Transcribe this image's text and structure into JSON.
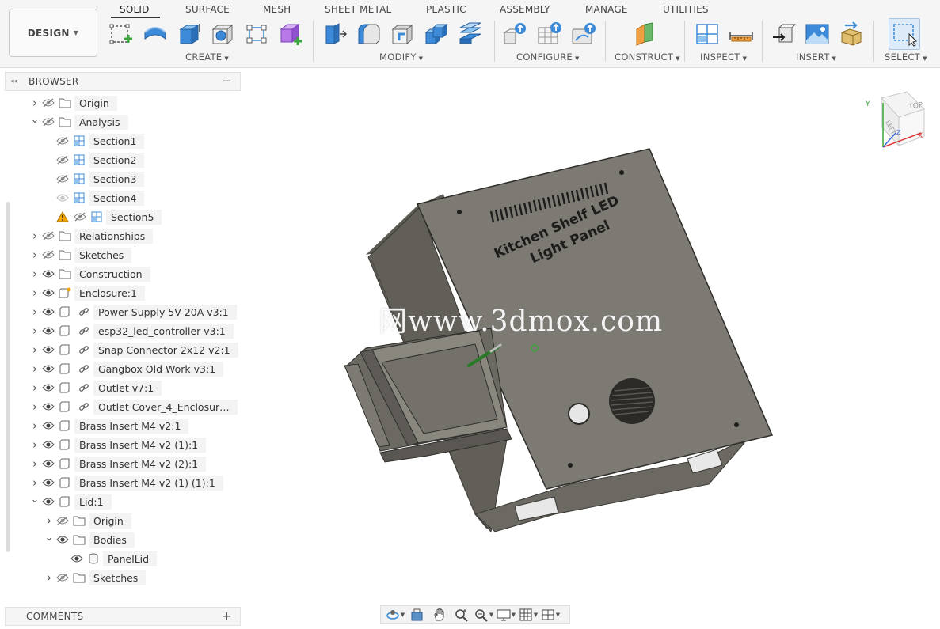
{
  "workspace": {
    "label": "DESIGN"
  },
  "tabs": [
    "SOLID",
    "SURFACE",
    "MESH",
    "SHEET METAL",
    "PLASTIC",
    "ASSEMBLY",
    "MANAGE",
    "UTILITIES"
  ],
  "active_tab": "SOLID",
  "groups": [
    "CREATE",
    "MODIFY",
    "CONFIGURE",
    "CONSTRUCT",
    "INSPECT",
    "INSERT",
    "SELECT"
  ],
  "browser": {
    "title": "BROWSER",
    "items": [
      {
        "label": "Origin",
        "depth": 0,
        "chevron": "right",
        "visible": false,
        "icon": "folder-icon"
      },
      {
        "label": "Analysis",
        "depth": 0,
        "chevron": "down",
        "visible": false,
        "icon": "folder-icon"
      },
      {
        "label": "Section1",
        "depth": 1,
        "chevron": "",
        "visible": false,
        "icon": "section-analysis-icon"
      },
      {
        "label": "Section2",
        "depth": 1,
        "chevron": "",
        "visible": false,
        "icon": "section-analysis-icon"
      },
      {
        "label": "Section3",
        "depth": 1,
        "chevron": "",
        "visible": false,
        "icon": "section-analysis-icon"
      },
      {
        "label": "Section4",
        "depth": 1,
        "chevron": "",
        "visible": true,
        "faded": true,
        "icon": "section-analysis-icon"
      },
      {
        "label": "Section5",
        "depth": 1,
        "chevron": "",
        "visible": false,
        "warning": true,
        "icon": "section-analysis-icon"
      },
      {
        "label": "Relationships",
        "depth": 0,
        "chevron": "right",
        "visible": false,
        "icon": "folder-icon"
      },
      {
        "label": "Sketches",
        "depth": 0,
        "chevron": "right",
        "visible": false,
        "icon": "folder-icon"
      },
      {
        "label": "Construction",
        "depth": 0,
        "chevron": "right",
        "visible": true,
        "icon": "folder-icon"
      },
      {
        "label": "Enclosure:1",
        "depth": 0,
        "chevron": "right",
        "visible": true,
        "icon": "active-component-icon"
      },
      {
        "label": "Power Supply 5V 20A v3:1",
        "depth": 0,
        "chevron": "right",
        "visible": true,
        "icon": "component-icon",
        "linked": true
      },
      {
        "label": "esp32_led_controller v3:1",
        "depth": 0,
        "chevron": "right",
        "visible": true,
        "icon": "component-icon",
        "linked": true
      },
      {
        "label": "Snap Connector 2x12 v2:1",
        "depth": 0,
        "chevron": "right",
        "visible": true,
        "icon": "component-icon",
        "linked": true
      },
      {
        "label": "Gangbox Old Work v3:1",
        "depth": 0,
        "chevron": "right",
        "visible": true,
        "icon": "component-icon",
        "linked": true
      },
      {
        "label": "Outlet v7:1",
        "depth": 0,
        "chevron": "right",
        "visible": true,
        "icon": "component-icon",
        "linked": true
      },
      {
        "label": "Outlet Cover_4_Enclosur…",
        "depth": 0,
        "chevron": "right",
        "visible": true,
        "icon": "component-icon",
        "linked": true
      },
      {
        "label": "Brass Insert M4 v2:1",
        "depth": 0,
        "chevron": "right",
        "visible": true,
        "icon": "component-icon"
      },
      {
        "label": "Brass Insert M4 v2 (1):1",
        "depth": 0,
        "chevron": "right",
        "visible": true,
        "icon": "component-icon"
      },
      {
        "label": "Brass Insert M4 v2 (2):1",
        "depth": 0,
        "chevron": "right",
        "visible": true,
        "icon": "component-icon"
      },
      {
        "label": "Brass Insert M4 v2 (1) (1):1",
        "depth": 0,
        "chevron": "right",
        "visible": true,
        "icon": "component-icon"
      },
      {
        "label": "Lid:1",
        "depth": 0,
        "chevron": "down",
        "visible": true,
        "icon": "component-icon"
      },
      {
        "label": "Origin",
        "depth": 1,
        "chevron": "right",
        "visible": false,
        "icon": "folder-icon"
      },
      {
        "label": "Bodies",
        "depth": 1,
        "chevron": "down",
        "visible": true,
        "icon": "folder-icon"
      },
      {
        "label": "PanelLid",
        "depth": 2,
        "chevron": "",
        "visible": true,
        "icon": "body-icon"
      },
      {
        "label": "Sketches",
        "depth": 1,
        "chevron": "right",
        "visible": false,
        "icon": "folder-icon"
      }
    ]
  },
  "comments": {
    "title": "COMMENTS"
  },
  "model": {
    "engraving_line1": "Kitchen Shelf LED",
    "engraving_line2": "Light Panel"
  },
  "viewcube": {
    "top": "TOP",
    "left": "LEFT",
    "axis_x": "X",
    "axis_y": "Y",
    "axis_z": "Z"
  },
  "watermark": "网www.3dmox.com",
  "colors": {
    "accent_blue": "#2d7fd2",
    "body_gray": "#7d7a74",
    "warning": "#f0a500",
    "active_tab_underline": "#333333"
  }
}
